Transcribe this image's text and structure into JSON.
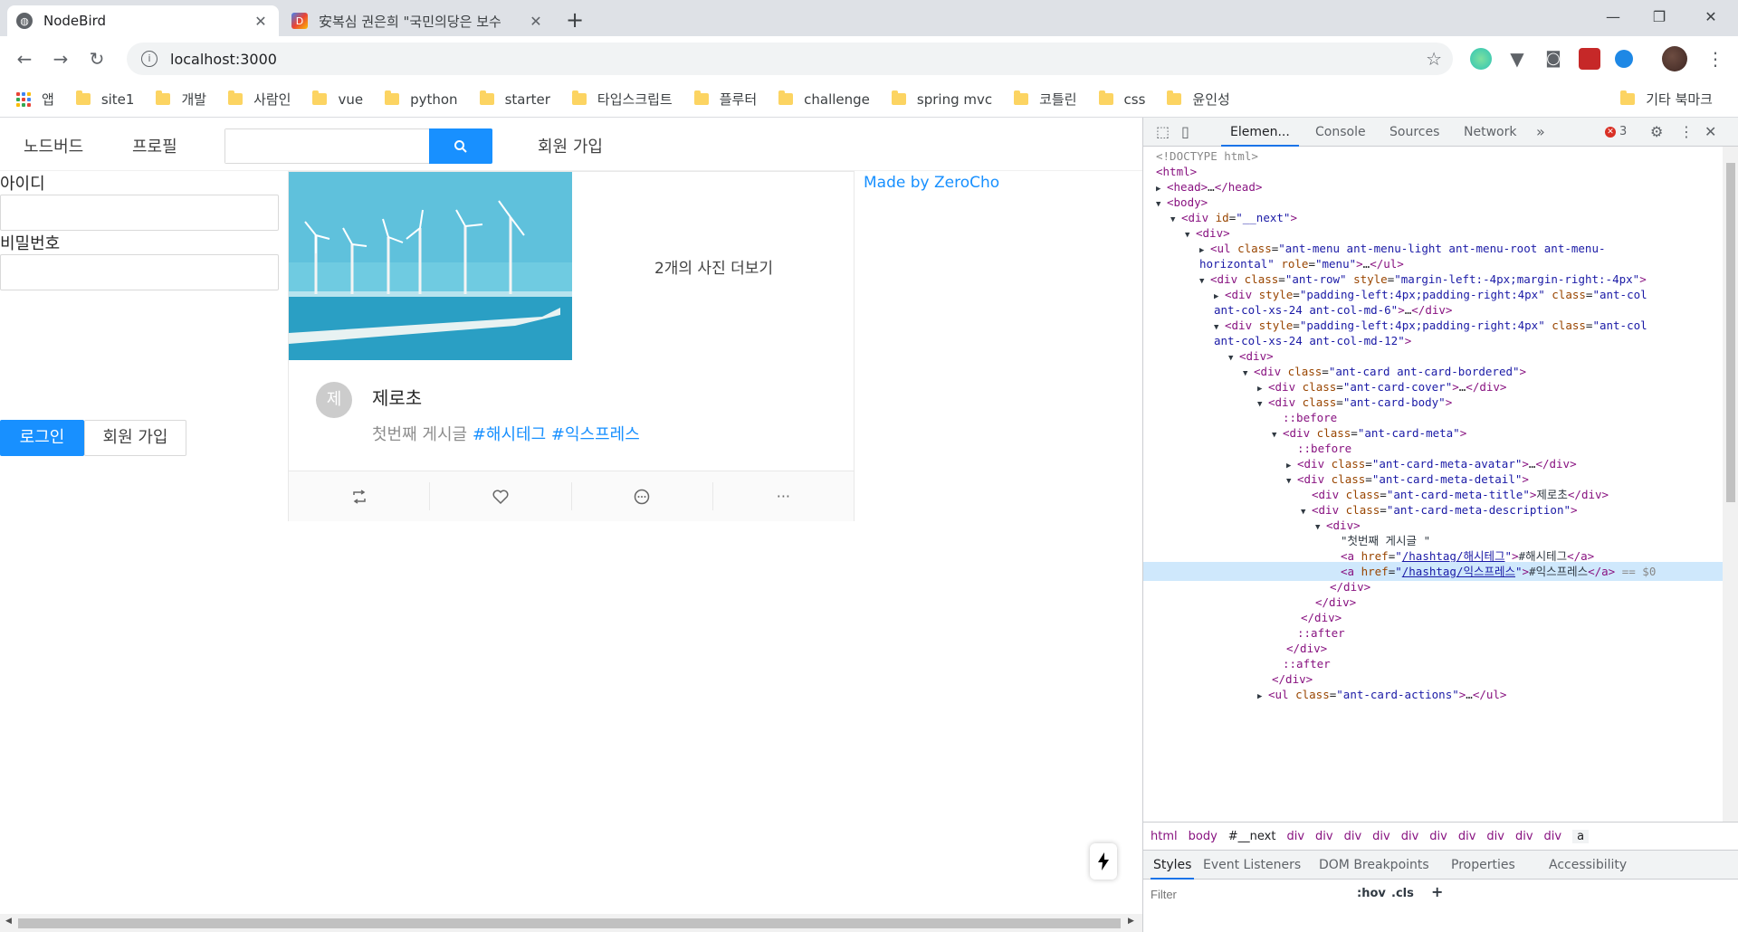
{
  "browser": {
    "tabs": [
      {
        "title": "NodeBird",
        "active": true
      },
      {
        "title": "安복심 권은희 \"국민의당은 보수",
        "active": false
      }
    ],
    "address": "localhost:3000",
    "bookmarks": [
      "site1",
      "개발",
      "사람인",
      "vue",
      "python",
      "starter",
      "타입스크립트",
      "플루터",
      "challenge",
      "spring mvc",
      "코틀린",
      "css",
      "윤인성"
    ],
    "apps_label": "앱",
    "other_bookmarks": "기타 북마크"
  },
  "app": {
    "menu": {
      "home": "노드버드",
      "profile": "프로필",
      "signup": "회원 가입",
      "search_value": ""
    },
    "login": {
      "id_label": "아이디",
      "password_label": "비밀번호",
      "login_button": "로그인",
      "signup_button": "회원 가입"
    },
    "post": {
      "more_photos": "2개의 사진 더보기",
      "avatar_initial": "제",
      "author": "제로초",
      "content_text": "첫번째 게시글 ",
      "hashtag1": "#해시테그",
      "hashtag2": "#익스프레스",
      "more_action": "···"
    },
    "footer_link": "Made by ZeroCho"
  },
  "devtools": {
    "tabs": [
      "Elemen...",
      "Console",
      "Sources",
      "Network"
    ],
    "error_count": "3",
    "breadcrumbs": [
      "html",
      "body",
      "#__next",
      "div",
      "div",
      "div",
      "div",
      "div",
      "div",
      "div",
      "div",
      "div",
      "div",
      "a"
    ],
    "styles_tabs": [
      "Styles",
      "Event Listeners",
      "DOM Breakpoints",
      "Properties",
      "Accessibility"
    ],
    "filter_placeholder": "Filter",
    "hov": ":hov",
    "cls": ".cls"
  },
  "colors": {
    "primary": "#1890ff",
    "tag": "#881280",
    "attr": "#994500",
    "value": "#1a1aa6"
  }
}
